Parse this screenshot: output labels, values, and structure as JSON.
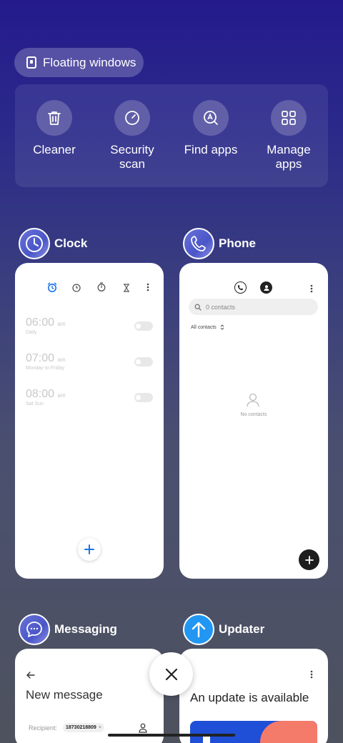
{
  "floating_windows": {
    "label": "Floating windows",
    "icon": "floating-window-icon"
  },
  "quick_actions": [
    {
      "label": "Cleaner",
      "icon": "trash-icon"
    },
    {
      "label": "Security\nscan",
      "icon": "security-scan-icon"
    },
    {
      "label": "Find apps",
      "icon": "find-apps-icon"
    },
    {
      "label": "Manage\napps",
      "icon": "grid-icon"
    }
  ],
  "apps": {
    "clock": {
      "name": "Clock",
      "alarms": [
        {
          "time": "06:00",
          "ampm": "am",
          "repeat": "Daily"
        },
        {
          "time": "07:00",
          "ampm": "am",
          "repeat": "Monday to Friday"
        },
        {
          "time": "08:00",
          "ampm": "am",
          "repeat": "Sat Sun"
        }
      ]
    },
    "phone": {
      "name": "Phone",
      "search_placeholder": "0 contacts",
      "filter_label": "All contacts",
      "empty_label": "No contacts"
    },
    "messaging": {
      "name": "Messaging",
      "title": "New message",
      "recipient_label": "Recipient:",
      "recipient_chip": "18730218809"
    },
    "updater": {
      "name": "Updater",
      "title": "An update is available"
    }
  },
  "colors": {
    "clock_accent": "#1a73e8",
    "updater_accent": "#2196f3"
  }
}
